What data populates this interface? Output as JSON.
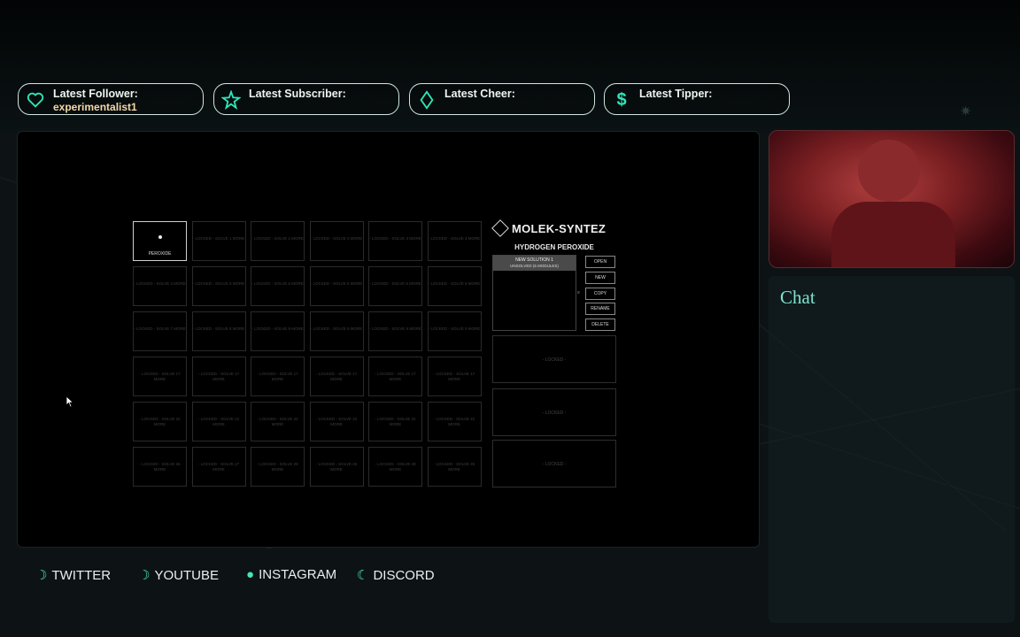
{
  "alerts": [
    {
      "icon": "heart-icon",
      "label": "Latest Follower:",
      "value": "experimentalist1"
    },
    {
      "icon": "star-icon",
      "label": "Latest Subscriber:",
      "value": ""
    },
    {
      "icon": "diamond-icon",
      "label": "Latest Cheer:",
      "value": ""
    },
    {
      "icon": "dollar-icon",
      "label": "Latest Tipper:",
      "value": ""
    }
  ],
  "game": {
    "puzzles": [
      "PEROXIDE",
      "- LOCKED - SOLVE 1 MORE",
      "- LOCKED - SOLVE 2 MORE",
      "- LOCKED - SOLVE 3 MORE",
      "- LOCKED - SOLVE 3 MORE",
      "- LOCKED - SOLVE 3 MORE",
      "- LOCKED - SOLVE 4 MORE",
      "- LOCKED - SOLVE 5 MORE",
      "- LOCKED - SOLVE 6 MORE",
      "- LOCKED - SOLVE 6 MORE",
      "- LOCKED - SOLVE 6 MORE",
      "- LOCKED - SOLVE 6 MORE",
      "- LOCKED - SOLVE 7 MORE",
      "- LOCKED - SOLVE 8 MORE",
      "- LOCKED - SOLVE 9 MORE",
      "- LOCKED - SOLVE 9 MORE",
      "- LOCKED - SOLVE 9 MORE",
      "- LOCKED - SOLVE 9 MORE",
      "- LOCKED - SOLVE 17 MORE",
      "- LOCKED - SOLVE 17 MORE",
      "- LOCKED - SOLVE 17 MORE",
      "- LOCKED - SOLVE 17 MORE",
      "- LOCKED - SOLVE 17 MORE",
      "- LOCKED - SOLVE 17 MORE",
      "- LOCKED - SOLVE 22 MORE",
      "- LOCKED - SOLVE 22 MORE",
      "- LOCKED - SOLVE 22 MORE",
      "- LOCKED - SOLVE 22 MORE",
      "- LOCKED - SOLVE 22 MORE",
      "- LOCKED - SOLVE 22 MORE",
      "- LOCKED - SOLVE 26 MORE",
      "- LOCKED - SOLVE 27 MORE",
      "- LOCKED - SOLVE 28 MORE",
      "- LOCKED - SOLVE 28 MORE",
      "- LOCKED - SOLVE 28 MORE",
      "- LOCKED - SOLVE 28 MORE"
    ],
    "title": "MOLEK-SYNTEZ",
    "puzzle_name": "HYDROGEN PEROXIDE",
    "solution_name": "NEW SOLUTION 1",
    "solution_status": "UNSOLVED (6 MODULES)",
    "buttons": [
      "OPEN",
      "NEW",
      "COPY",
      "RENAME",
      "DELETE"
    ],
    "scroll_arrow": "≡",
    "panel_slots": [
      "- LOCKED -",
      "- LOCKED -",
      "- LOCKED -"
    ]
  },
  "chat": {
    "title": "Chat"
  },
  "social": [
    {
      "icon": "twitter-icon",
      "glyph": "☽",
      "label": "TWITTER"
    },
    {
      "icon": "youtube-icon",
      "glyph": "☽",
      "label": "YOUTUBE"
    },
    {
      "icon": "instagram-icon",
      "glyph": "●",
      "label": "INSTAGRAM"
    },
    {
      "icon": "discord-icon",
      "glyph": "☾",
      "label": "DISCORD"
    }
  ],
  "colors": {
    "accent": "#2ee6b9",
    "follower_value": "#f3d9a8",
    "chat_title": "#7fe3cc"
  }
}
